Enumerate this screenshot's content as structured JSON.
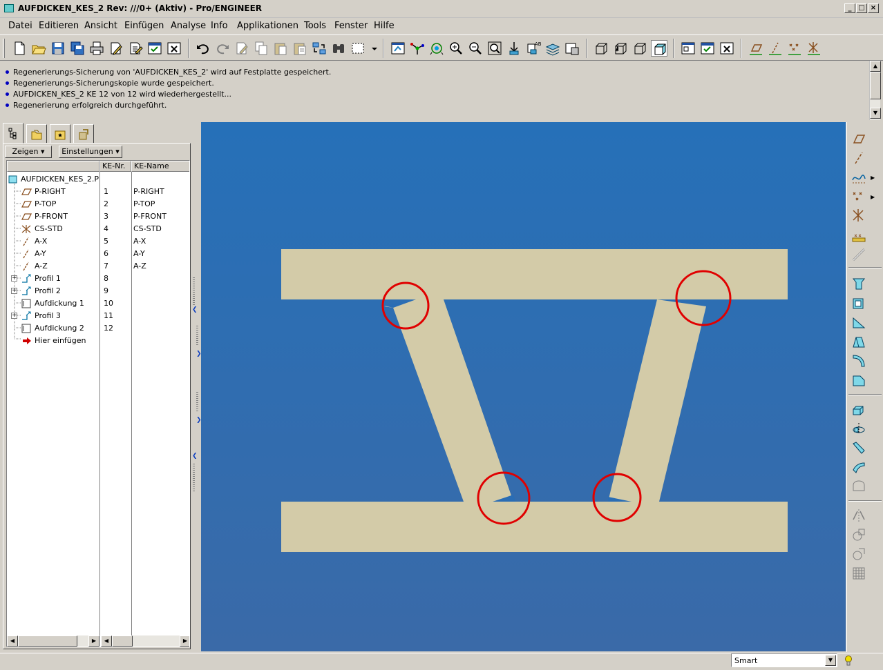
{
  "window": {
    "title": "AUFDICKEN_KES_2 Rev: ///0+ (Aktiv) - Pro/ENGINEER",
    "minimize": "_",
    "maximize": "□",
    "close": "×"
  },
  "menu": [
    {
      "label": "Datei"
    },
    {
      "label": "Editieren"
    },
    {
      "label": "Ansicht"
    },
    {
      "label": "Einfügen"
    },
    {
      "label": "Analyse"
    },
    {
      "label": "Info"
    },
    {
      "label": "Applikationen"
    },
    {
      "label": "Tools"
    },
    {
      "label": "Fenster"
    },
    {
      "label": "Hilfe"
    }
  ],
  "messages": [
    "Regenerierungs-Sicherung von 'AUFDICKEN_KES_2' wird auf Festplatte gespeichert.",
    "Regenerierungs-Sicherungskopie wurde gespeichert.",
    "AUFDICKEN_KES_2 KE 12 von 12 wird wiederhergestellt...",
    "Regenerierung erfolgreich durchgeführt."
  ],
  "model_tree": {
    "buttons": {
      "show": "Zeigen",
      "settings": "Einstellungen"
    },
    "columns": {
      "name": "",
      "nr": "KE-Nr.",
      "ke_name": "KE-Name"
    },
    "root": "AUFDICKEN_KES_2.P",
    "rows": [
      {
        "name": "P-RIGHT",
        "nr": "1",
        "ke_name": "P-RIGHT",
        "icon": "datum-plane-icon",
        "expandable": false
      },
      {
        "name": "P-TOP",
        "nr": "2",
        "ke_name": "P-TOP",
        "icon": "datum-plane-icon",
        "expandable": false
      },
      {
        "name": "P-FRONT",
        "nr": "3",
        "ke_name": "P-FRONT",
        "icon": "datum-plane-icon",
        "expandable": false
      },
      {
        "name": "CS-STD",
        "nr": "4",
        "ke_name": "CS-STD",
        "icon": "coordinate-system-icon",
        "expandable": false
      },
      {
        "name": "A-X",
        "nr": "5",
        "ke_name": "A-X",
        "icon": "datum-axis-icon",
        "expandable": false
      },
      {
        "name": "A-Y",
        "nr": "6",
        "ke_name": "A-Y",
        "icon": "datum-axis-icon",
        "expandable": false
      },
      {
        "name": "A-Z",
        "nr": "7",
        "ke_name": "A-Z",
        "icon": "datum-axis-icon",
        "expandable": false
      },
      {
        "name": "Profil 1",
        "nr": "8",
        "ke_name": "",
        "icon": "sketch-icon",
        "expandable": true
      },
      {
        "name": "Profil 2",
        "nr": "9",
        "ke_name": "",
        "icon": "sketch-icon",
        "expandable": true
      },
      {
        "name": "Aufdickung 1",
        "nr": "10",
        "ke_name": "",
        "icon": "thicken-icon",
        "expandable": false
      },
      {
        "name": "Profil 3",
        "nr": "11",
        "ke_name": "",
        "icon": "sketch-icon",
        "expandable": true
      },
      {
        "name": "Aufdickung 2",
        "nr": "12",
        "ke_name": "",
        "icon": "thicken-icon",
        "expandable": false
      },
      {
        "name": "Hier einfügen",
        "nr": "",
        "ke_name": "",
        "icon": "insert-here-arrow-icon",
        "expandable": false
      }
    ]
  },
  "status": {
    "filter_value": "Smart"
  },
  "colors": {
    "canvas_top": "#2670b8",
    "canvas_bottom": "#3a6aa8",
    "part_fill": "#d3cba8",
    "highlight_circle": "#e00000"
  }
}
